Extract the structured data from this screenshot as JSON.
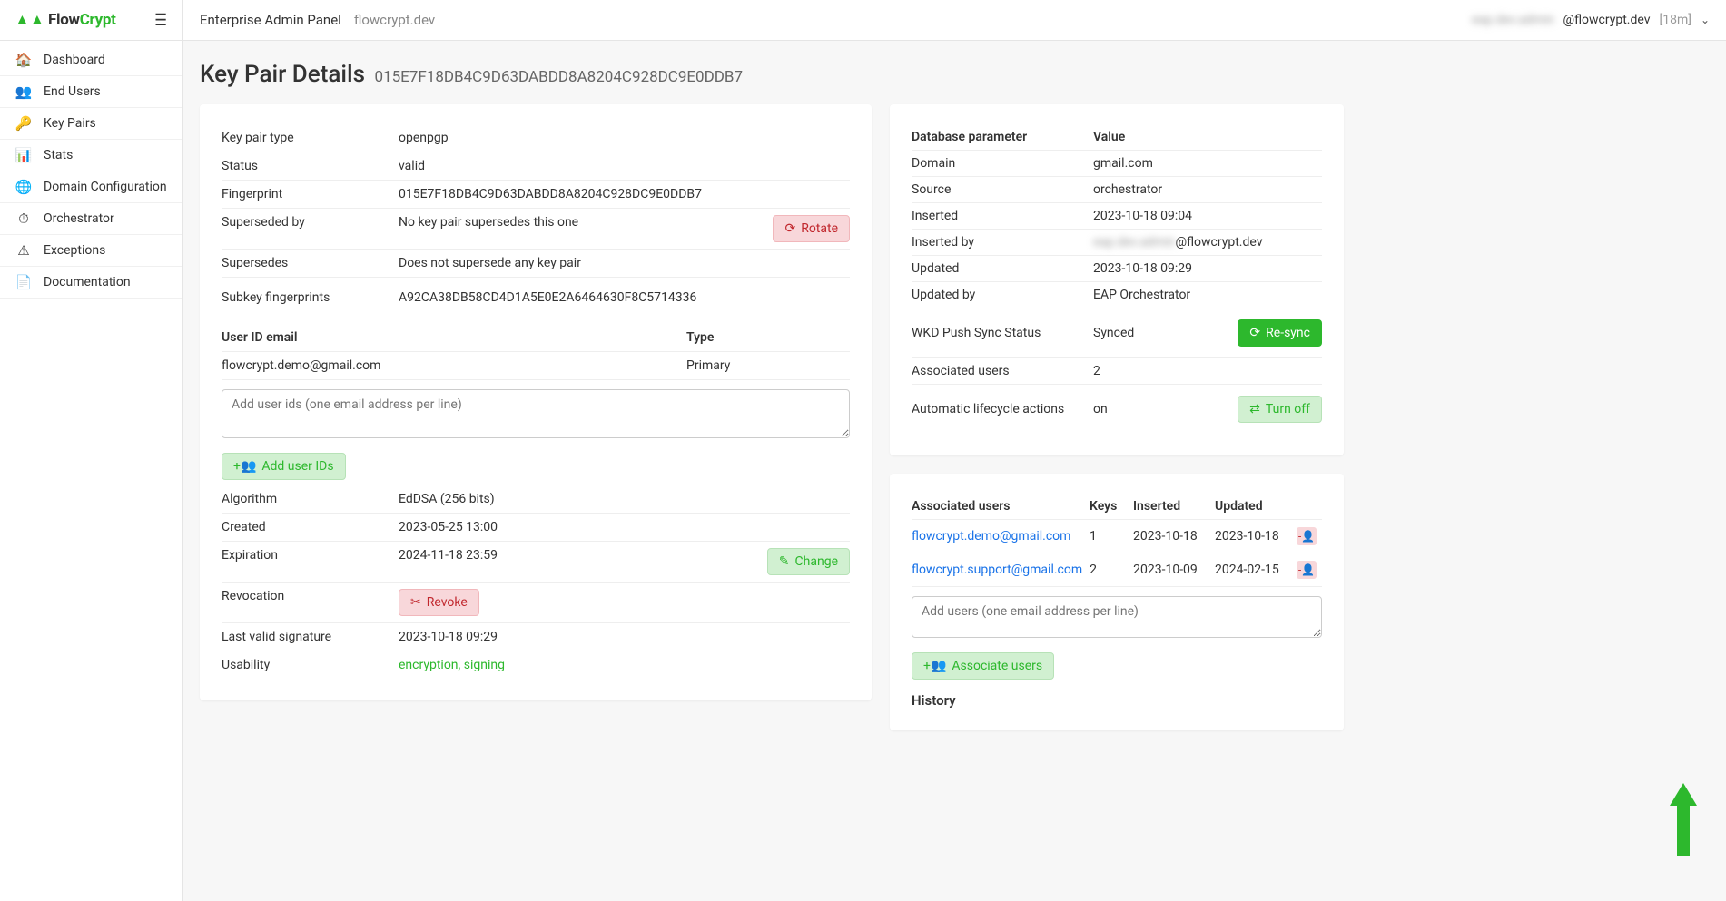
{
  "brand": {
    "part1": "Flow",
    "part2": "Crypt"
  },
  "topbar": {
    "title": "Enterprise Admin Panel",
    "domain": "flowcrypt.dev",
    "user_hidden": "eap.dev.admin",
    "user_domain": "@flowcrypt.dev",
    "session": "[18m]"
  },
  "nav": [
    {
      "icon": "home-icon",
      "glyph": "🏠",
      "label": "Dashboard"
    },
    {
      "icon": "users-icon",
      "glyph": "👥",
      "label": "End Users"
    },
    {
      "icon": "key-icon",
      "glyph": "🔑",
      "label": "Key Pairs"
    },
    {
      "icon": "stats-icon",
      "glyph": "📊",
      "label": "Stats"
    },
    {
      "icon": "globe-icon",
      "glyph": "🌐",
      "label": "Domain Configuration"
    },
    {
      "icon": "clock-icon",
      "glyph": "⏱",
      "label": "Orchestrator"
    },
    {
      "icon": "warning-icon",
      "glyph": "⚠",
      "label": "Exceptions"
    },
    {
      "icon": "doc-icon",
      "glyph": "📄",
      "label": "Documentation"
    }
  ],
  "page": {
    "title": "Key Pair Details",
    "fingerprint": "015E7F18DB4C9D63DABDD8A8204C928DC9E0DDB7"
  },
  "details": {
    "key_pair_type_label": "Key pair type",
    "key_pair_type": "openpgp",
    "status_label": "Status",
    "status": "valid",
    "fingerprint_label": "Fingerprint",
    "fingerprint": "015E7F18DB4C9D63DABDD8A8204C928DC9E0DDB7",
    "superseded_by_label": "Superseded by",
    "superseded_by": "No key pair supersedes this one",
    "rotate_btn": "Rotate",
    "supersedes_label": "Supersedes",
    "supersedes": "Does not supersede any key pair",
    "subkey_label": "Subkey fingerprints",
    "subkey": "A92CA38DB58CD4D1A5E0E2A6464630F8C5714336",
    "uid_header_email": "User ID email",
    "uid_header_type": "Type",
    "uid_rows": [
      {
        "email": "flowcrypt.demo@gmail.com",
        "type": "Primary"
      }
    ],
    "add_uid_placeholder": "Add user ids (one email address per line)",
    "add_uid_btn": "Add user IDs",
    "algorithm_label": "Algorithm",
    "algorithm": "EdDSA (256 bits)",
    "created_label": "Created",
    "created": "2023-05-25 13:00",
    "expiration_label": "Expiration",
    "expiration": "2024-11-18 23:59",
    "change_btn": "Change",
    "revocation_label": "Revocation",
    "revoke_btn": "Revoke",
    "last_sig_label": "Last valid signature",
    "last_sig": "2023-10-18 09:29",
    "usability_label": "Usability",
    "usability_1": "encryption",
    "usability_2": "signing"
  },
  "right": {
    "hdr_param": "Database parameter",
    "hdr_value": "Value",
    "rows": [
      {
        "label": "Domain",
        "value": "gmail.com"
      },
      {
        "label": "Source",
        "value": "orchestrator"
      },
      {
        "label": "Inserted",
        "value": "2023-10-18 09:04"
      },
      {
        "label": "Inserted by",
        "value_hidden": "eap.dev.admin",
        "value_suffix": "@flowcrypt.dev"
      },
      {
        "label": "Updated",
        "value": "2023-10-18 09:29"
      },
      {
        "label": "Updated by",
        "value": "EAP Orchestrator"
      }
    ],
    "wkd_label": "WKD Push Sync Status",
    "wkd_value": "Synced",
    "resync_btn": "Re-sync",
    "assoc_count_label": "Associated users",
    "assoc_count": "2",
    "lifecycle_label": "Automatic lifecycle actions",
    "lifecycle_value": "on",
    "turn_off_btn": "Turn off"
  },
  "assoc": {
    "title": "Associated users",
    "col_keys": "Keys",
    "col_inserted": "Inserted",
    "col_updated": "Updated",
    "rows": [
      {
        "email": "flowcrypt.demo@gmail.com",
        "keys": "1",
        "inserted": "2023-10-18",
        "updated": "2023-10-18"
      },
      {
        "email": "flowcrypt.support@gmail.com",
        "keys": "2",
        "inserted": "2023-10-09",
        "updated": "2024-02-15"
      }
    ],
    "add_placeholder": "Add users (one email address per line)",
    "associate_btn": "Associate users",
    "history_title": "History"
  }
}
